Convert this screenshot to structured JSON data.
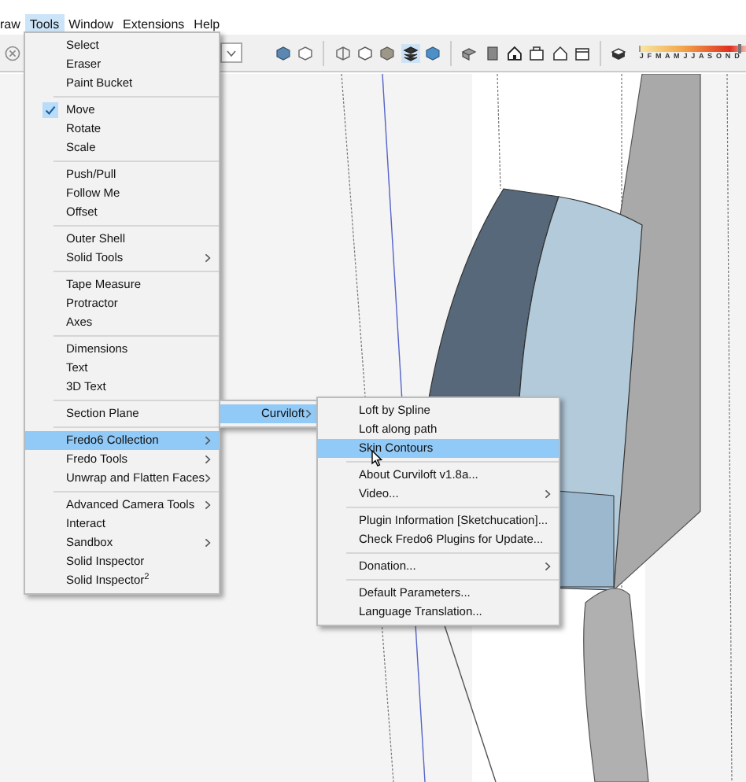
{
  "menubar": [
    {
      "label": "raw",
      "selected": false
    },
    {
      "label": "Tools",
      "selected": true
    },
    {
      "label": "Window",
      "selected": false
    },
    {
      "label": "Extensions",
      "selected": false
    },
    {
      "label": "Help",
      "selected": false
    }
  ],
  "toolbar": {
    "shadow_months": "J F M A M J J A S O N D",
    "shadow_slider": {
      "level": 0.92
    }
  },
  "tools_menu": [
    {
      "kind": "item",
      "label": "Select",
      "checked": false,
      "submenu": false,
      "selected": false
    },
    {
      "kind": "item",
      "label": "Eraser",
      "checked": false,
      "submenu": false,
      "selected": false
    },
    {
      "kind": "item",
      "label": "Paint Bucket",
      "checked": false,
      "submenu": false,
      "selected": false
    },
    {
      "kind": "separator"
    },
    {
      "kind": "item",
      "label": "Move",
      "checked": true,
      "submenu": false,
      "selected": false
    },
    {
      "kind": "item",
      "label": "Rotate",
      "checked": false,
      "submenu": false,
      "selected": false
    },
    {
      "kind": "item",
      "label": "Scale",
      "checked": false,
      "submenu": false,
      "selected": false
    },
    {
      "kind": "separator"
    },
    {
      "kind": "item",
      "label": "Push/Pull",
      "checked": false,
      "submenu": false,
      "selected": false
    },
    {
      "kind": "item",
      "label": "Follow Me",
      "checked": false,
      "submenu": false,
      "selected": false
    },
    {
      "kind": "item",
      "label": "Offset",
      "checked": false,
      "submenu": false,
      "selected": false
    },
    {
      "kind": "separator"
    },
    {
      "kind": "item",
      "label": "Outer Shell",
      "checked": false,
      "submenu": false,
      "selected": false
    },
    {
      "kind": "item",
      "label": "Solid Tools",
      "checked": false,
      "submenu": true,
      "selected": false
    },
    {
      "kind": "separator"
    },
    {
      "kind": "item",
      "label": "Tape Measure",
      "checked": false,
      "submenu": false,
      "selected": false
    },
    {
      "kind": "item",
      "label": "Protractor",
      "checked": false,
      "submenu": false,
      "selected": false
    },
    {
      "kind": "item",
      "label": "Axes",
      "checked": false,
      "submenu": false,
      "selected": false
    },
    {
      "kind": "separator"
    },
    {
      "kind": "item",
      "label": "Dimensions",
      "checked": false,
      "submenu": false,
      "selected": false
    },
    {
      "kind": "item",
      "label": "Text",
      "checked": false,
      "submenu": false,
      "selected": false
    },
    {
      "kind": "item",
      "label": "3D Text",
      "checked": false,
      "submenu": false,
      "selected": false
    },
    {
      "kind": "separator"
    },
    {
      "kind": "item",
      "label": "Section Plane",
      "checked": false,
      "submenu": false,
      "selected": false
    },
    {
      "kind": "separator"
    },
    {
      "kind": "item",
      "label": "Fredo6 Collection",
      "checked": false,
      "submenu": true,
      "selected": true
    },
    {
      "kind": "item",
      "label": "Fredo Tools",
      "checked": false,
      "submenu": true,
      "selected": false
    },
    {
      "kind": "item",
      "label": "Unwrap and Flatten Faces",
      "checked": false,
      "submenu": true,
      "selected": false
    },
    {
      "kind": "separator"
    },
    {
      "kind": "item",
      "label": "Advanced Camera Tools",
      "checked": false,
      "submenu": true,
      "selected": false
    },
    {
      "kind": "item",
      "label": "Interact",
      "checked": false,
      "submenu": false,
      "selected": false
    },
    {
      "kind": "item",
      "label": "Sandbox",
      "checked": false,
      "submenu": true,
      "selected": false
    },
    {
      "kind": "item",
      "label": "Solid Inspector",
      "checked": false,
      "submenu": false,
      "selected": false
    },
    {
      "kind": "item",
      "label": "Solid Inspector$^{2}$",
      "checked": false,
      "submenu": false,
      "selected": false
    }
  ],
  "fredo6_menu": [
    {
      "kind": "item",
      "label": "Curviloft",
      "checked": false,
      "submenu": true,
      "selected": true
    }
  ],
  "curviloft_menu": [
    {
      "kind": "item",
      "label": "Loft by Spline",
      "checked": false,
      "submenu": false,
      "selected": false
    },
    {
      "kind": "item",
      "label": "Loft along path",
      "checked": false,
      "submenu": false,
      "selected": false
    },
    {
      "kind": "item",
      "label": "Skin Contours",
      "checked": false,
      "submenu": false,
      "selected": true
    },
    {
      "kind": "separator"
    },
    {
      "kind": "item",
      "label": "About Curviloft v1.8a...",
      "checked": false,
      "submenu": false,
      "selected": false
    },
    {
      "kind": "item",
      "label": "Video...",
      "checked": false,
      "submenu": true,
      "selected": false
    },
    {
      "kind": "separator"
    },
    {
      "kind": "item",
      "label": "Plugin Information [Sketchucation]...",
      "checked": false,
      "submenu": false,
      "selected": false
    },
    {
      "kind": "item",
      "label": "Check Fredo6 Plugins for Update...",
      "checked": false,
      "submenu": false,
      "selected": false
    },
    {
      "kind": "separator"
    },
    {
      "kind": "item",
      "label": "Donation...",
      "checked": false,
      "submenu": true,
      "selected": false
    },
    {
      "kind": "separator"
    },
    {
      "kind": "item",
      "label": "Default Parameters...",
      "checked": false,
      "submenu": false,
      "selected": false
    },
    {
      "kind": "item",
      "label": "Language Translation...",
      "checked": false,
      "submenu": false,
      "selected": false
    }
  ]
}
